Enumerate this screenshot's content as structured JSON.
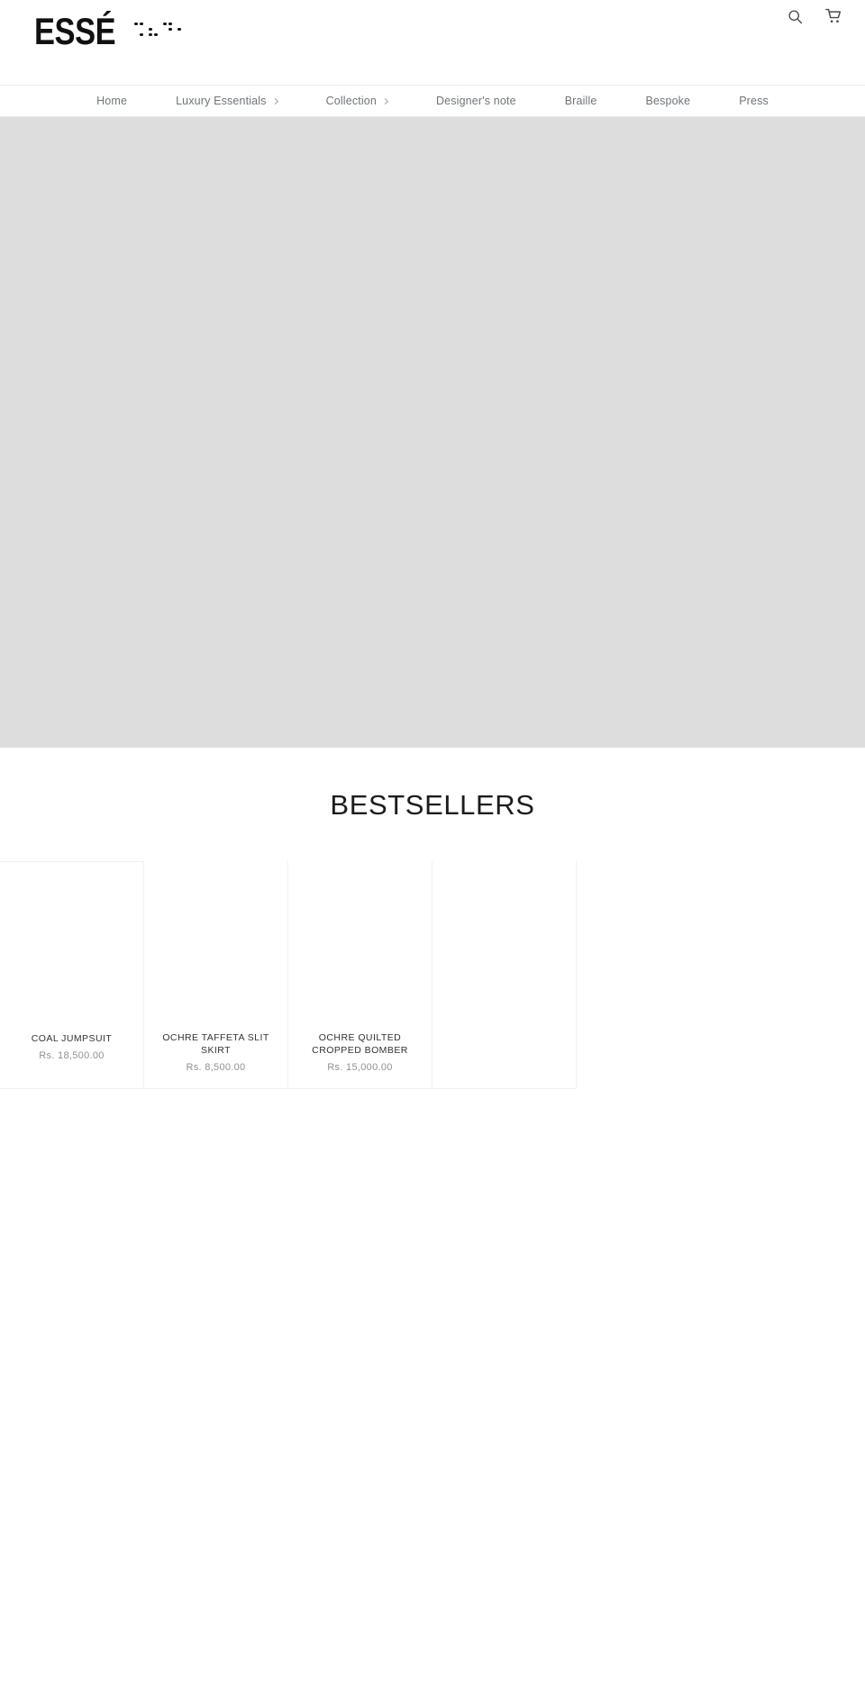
{
  "header": {
    "logo_text": "ESSÉ",
    "logo_alt": "ESSÉ braille logo",
    "braille_cells": [
      [
        1,
        0,
        0,
        1,
        0,
        1
      ],
      [
        0,
        1,
        1,
        0,
        0,
        1
      ],
      [
        1,
        0,
        0,
        1,
        1,
        0
      ],
      [
        0,
        1,
        0,
        0,
        0,
        0
      ]
    ],
    "icons": [
      {
        "name": "search-icon",
        "label": "Search"
      },
      {
        "name": "cart-icon",
        "label": "Cart"
      }
    ]
  },
  "nav": {
    "items": [
      {
        "label": "Home",
        "has_submenu": false
      },
      {
        "label": "Luxury Essentials",
        "has_submenu": true
      },
      {
        "label": "Collection",
        "has_submenu": true
      },
      {
        "label": "Designer's note",
        "has_submenu": false
      },
      {
        "label": "Braille",
        "has_submenu": false
      },
      {
        "label": "Bespoke",
        "has_submenu": false
      },
      {
        "label": "Press",
        "has_submenu": false
      }
    ]
  },
  "hero": {
    "background_color": "#dddddd"
  },
  "bestsellers": {
    "heading": "BESTSELLERS",
    "products": [
      {
        "title": "COAL JUMPSUIT",
        "price": "Rs. 18,500.00"
      },
      {
        "title": "OCHRE TAFFETA SLIT SKIRT",
        "price": "Rs. 8,500.00"
      },
      {
        "title": "OCHRE QUILTED CROPPED BOMBER",
        "price": "Rs. 15,000.00"
      },
      {
        "title": "",
        "price": ""
      }
    ]
  },
  "colors": {
    "text": "#2e3337",
    "muted": "#8d9296",
    "nav": "#6e7579",
    "hero": "#dddddd",
    "border": "#f0f0f0"
  }
}
